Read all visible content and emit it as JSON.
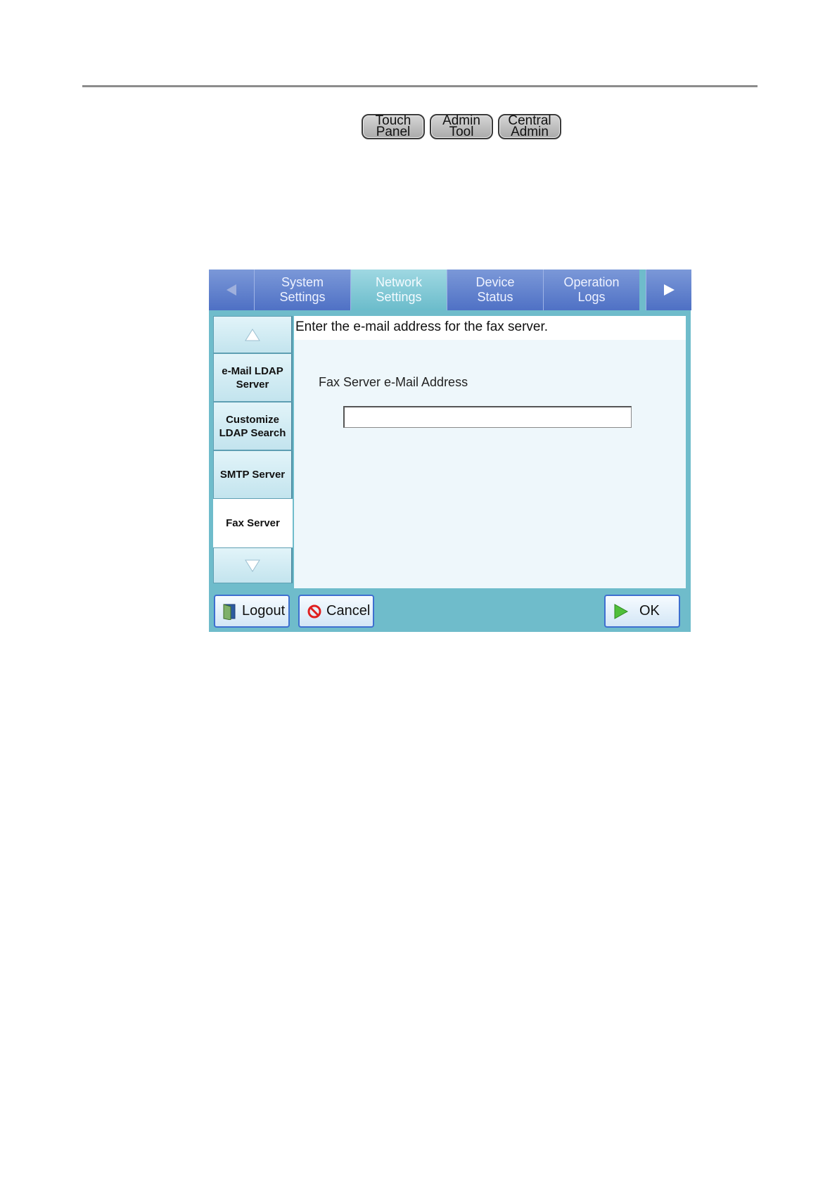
{
  "mode_buttons": [
    {
      "line1": "Touch",
      "line2": "Panel"
    },
    {
      "line1": "Admin",
      "line2": "Tool"
    },
    {
      "line1": "Central",
      "line2": "Admin"
    }
  ],
  "tabs": [
    {
      "line1": "System",
      "line2": "Settings"
    },
    {
      "line1": "Network",
      "line2": "Settings"
    },
    {
      "line1": "Device",
      "line2": "Status"
    },
    {
      "line1": "Operation",
      "line2": "Logs"
    }
  ],
  "active_tab": "Network Settings",
  "sidebar": {
    "items": [
      {
        "line1": "e-Mail LDAP",
        "line2": "Server"
      },
      {
        "line1": "Customize",
        "line2": "LDAP Search"
      },
      {
        "line1": "SMTP Server",
        "line2": ""
      },
      {
        "line1": "Fax Server",
        "line2": ""
      }
    ],
    "selected": "Fax Server"
  },
  "content": {
    "instruction": "Enter the e-mail address for the fax server.",
    "field_label": "Fax Server e-Mail Address",
    "field_value": ""
  },
  "footer": {
    "logout_label": "Logout",
    "cancel_label": "Cancel",
    "ok_label": "OK"
  },
  "colors": {
    "tab_blue": "#5b7ccc",
    "active_tab": "#86ccd8",
    "panel_teal": "#6fbccb",
    "button_border": "#3e6fd0"
  }
}
